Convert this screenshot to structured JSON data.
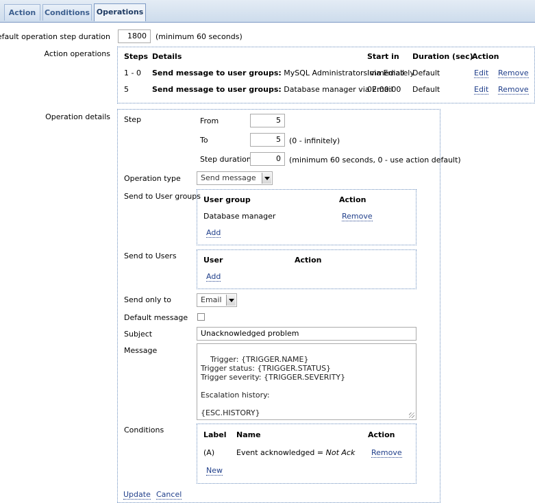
{
  "tabs": [
    {
      "label": "Action"
    },
    {
      "label": "Conditions"
    },
    {
      "label": "Operations"
    }
  ],
  "step_duration": {
    "label": "Default operation step duration",
    "value": "1800",
    "hint": "(minimum 60 seconds)"
  },
  "action_operations": {
    "label": "Action operations",
    "headers": {
      "steps": "Steps",
      "details": "Details",
      "start": "Start in",
      "duration": "Duration (sec)",
      "action": "Action"
    },
    "rows": [
      {
        "steps": "1 - 0",
        "details_bold": "Send message to user groups:",
        "details_rest": " MySQL Administrators via Email",
        "start": "Immediately",
        "duration": "Default",
        "edit": "Edit",
        "remove": "Remove"
      },
      {
        "steps": "5",
        "details_bold": "Send message to user groups:",
        "details_rest": " Database manager via Email",
        "start": "02:00:00",
        "duration": "Default",
        "edit": "Edit",
        "remove": "Remove"
      }
    ]
  },
  "operation_details": {
    "label": "Operation details",
    "step": {
      "label": "Step",
      "from_label": "From",
      "from_value": "5",
      "to_label": "To",
      "to_value": "5",
      "to_hint": "(0 - infinitely)",
      "duration_label": "Step duration",
      "duration_value": "0",
      "duration_hint": "(minimum 60 seconds, 0 - use action default)"
    },
    "operation_type": {
      "label": "Operation type",
      "value": "Send message"
    },
    "user_groups": {
      "label": "Send to User groups",
      "col_group": "User group",
      "col_action": "Action",
      "rows": [
        {
          "name": "Database manager",
          "remove": "Remove"
        }
      ],
      "add": "Add"
    },
    "users": {
      "label": "Send to Users",
      "col_user": "User",
      "col_action": "Action",
      "add": "Add"
    },
    "send_only_to": {
      "label": "Send only to",
      "value": "Email"
    },
    "default_message": {
      "label": "Default message",
      "checked": false
    },
    "subject": {
      "label": "Subject",
      "value": "Unacknowledged problem"
    },
    "message": {
      "label": "Message",
      "value": "Trigger: {TRIGGER.NAME}\nTrigger status: {TRIGGER.STATUS}\nTrigger severity: {TRIGGER.SEVERITY}\n\nEscalation history:\n\n{ESC.HISTORY}"
    },
    "conditions": {
      "label": "Conditions",
      "col_label": "Label",
      "col_name": "Name",
      "col_action": "Action",
      "rows": [
        {
          "label": "(A)",
          "name_prefix": "Event acknowledged = ",
          "name_value": "Not Ack",
          "remove": "Remove"
        }
      ],
      "new": "New"
    },
    "update": "Update",
    "cancel": "Cancel"
  }
}
